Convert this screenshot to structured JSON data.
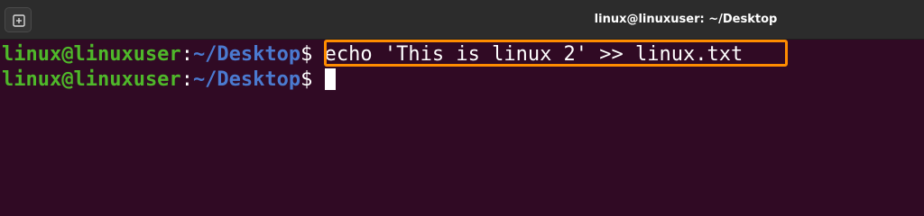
{
  "window": {
    "title": "linux@linuxuser: ~/Desktop",
    "new_tab_icon": "new-tab-icon"
  },
  "terminal": {
    "lines": [
      {
        "user": "linux@linuxuser",
        "colon": ":",
        "path": "~/Desktop",
        "prompt": "$",
        "command": " echo 'This is linux 2' >> linux.txt"
      },
      {
        "user": "linux@linuxuser",
        "colon": ":",
        "path": "~/Desktop",
        "prompt": "$",
        "command": " "
      }
    ]
  },
  "colors": {
    "background": "#300a24",
    "user": "#4fb82a",
    "path": "#4b7ad0",
    "highlight": "#ff8c00"
  }
}
